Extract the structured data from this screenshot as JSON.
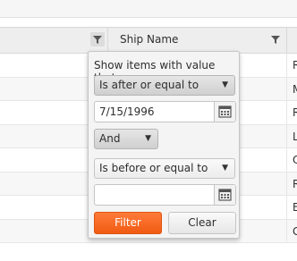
{
  "header": {
    "ship_name_label": "Ship Name"
  },
  "row_letters": [
    "R",
    "M",
    "R",
    "L",
    "C",
    "R",
    "E",
    "G"
  ],
  "filter_menu": {
    "help_text": "Show items with value that:",
    "operator1": "Is after or equal to",
    "value1": "7/15/1996",
    "logic": "And",
    "operator2": "Is before or equal to",
    "value2": "",
    "filter_label": "Filter",
    "clear_label": "Clear"
  },
  "colors": {
    "accent": "#f35800",
    "header_bg": "#eeeeee",
    "popup_bg": "#f4f4f4"
  },
  "icons": {
    "column_filter": "filter-funnel-icon",
    "date_picker": "calendar-icon",
    "dropdown": "triangle-down-icon"
  }
}
